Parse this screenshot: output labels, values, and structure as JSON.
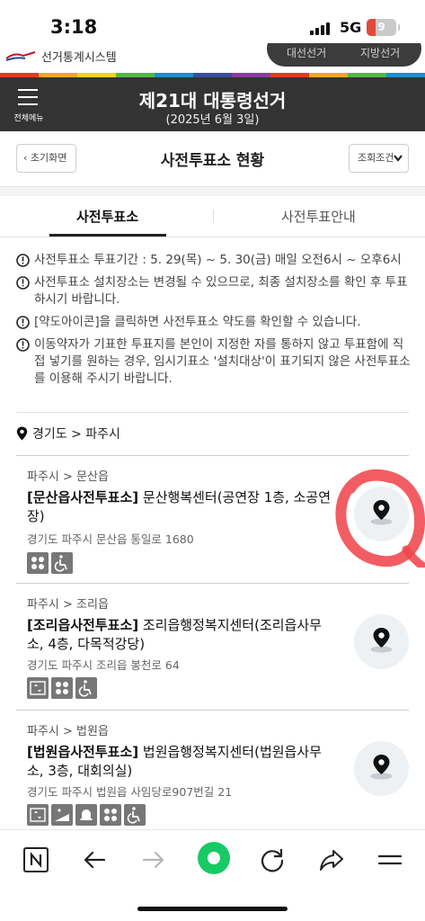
{
  "status_bar": {
    "time": "3:18",
    "network": "5G",
    "battery": "9"
  },
  "site": {
    "name": "선거통계시스템",
    "toggle_left": "대선선거",
    "toggle_right": "지방선거"
  },
  "header": {
    "menu_label": "전체메뉴",
    "title": "제21대 대통령선거",
    "subtitle": "(2025년 6월 3일)"
  },
  "subbar": {
    "reset_label": "초기화면",
    "page_title": "사전투표소 현황",
    "condition_label": "조회조건"
  },
  "tabs": [
    {
      "label": "사전투표소"
    },
    {
      "label": "사전투표안내"
    }
  ],
  "notices": [
    "사전투표소 투표기간 : 5. 29(목) ~ 5. 30(금) 매일 오전6시 ~ 오후6시",
    "사전투표소 설치장소는 변경될 수 있으므로, 최종 설치장소를 확인 후 투표하시기 바랍니다.",
    "[약도아이콘]을 클릭하면 사전투표소 약도를 확인할 수 있습니다.",
    "이동약자가 기표한 투표지를 본인이 지정한 자를 통하지 않고 투표함에 직접 넣기를 원하는 경우, 임시기표소 '설치대상'이 표기되지 않은 사전투표소를 이용해 주시기 바랍니다."
  ],
  "location": {
    "text": "경기도 > 파주시"
  },
  "stations": [
    {
      "region": "파주시 > 문산읍",
      "name_bracket": "[문산읍사전투표소]",
      "name_rest": " 문산행복센터(공연장 1층, 소공연장)",
      "address": "경기도 파주시 문산읍 통일로 1680",
      "icons": [
        "table-icon",
        "wheelchair-icon"
      ]
    },
    {
      "region": "파주시 > 조리읍",
      "name_bracket": "[조리읍사전투표소]",
      "name_rest": " 조리읍행정복지센터(조리읍사무소, 4층, 다목적강당)",
      "address": "경기도 파주시 조리읍 봉천로 64",
      "icons": [
        "elevator-icon",
        "table-icon",
        "wheelchair-icon"
      ]
    },
    {
      "region": "파주시 > 법원읍",
      "name_bracket": "[법원읍사전투표소]",
      "name_rest": " 법원읍행정복지센터(법원읍사무소, 3층, 대회의실)",
      "address": "경기도 파주시 법원읍 사임당로907번길 21",
      "icons": [
        "elevator-icon",
        "ramp-icon",
        "bell-icon",
        "table-icon",
        "wheelchair-icon"
      ]
    }
  ],
  "colors": {
    "header_bg": "#333333",
    "annotation_red": "#f0474d",
    "browser_green": "#18c964"
  }
}
